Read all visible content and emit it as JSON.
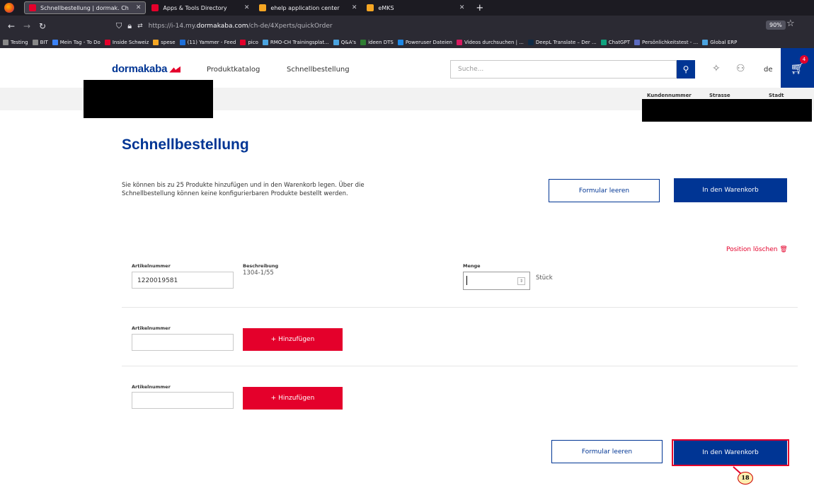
{
  "browser": {
    "tabs": [
      {
        "label": "Schnellbestellung | dormak. Ch",
        "color": "#e4002b",
        "active": true
      },
      {
        "label": "Apps & Tools Directory",
        "color": "#e4002b",
        "active": false
      },
      {
        "label": "ehelp application center",
        "color": "#f5a623",
        "active": false
      },
      {
        "label": "eMKS",
        "color": "#f5a623",
        "active": false
      }
    ],
    "url_prefix": "https://i-14.my.",
    "url_host": "dormakaba.com",
    "url_path": "/ch-de/4Xperts/quickOrder",
    "zoom": "90%",
    "bookmarks": [
      {
        "label": "Testing",
        "color": "#888888"
      },
      {
        "label": "BIT",
        "color": "#888888"
      },
      {
        "label": "Mein Tag - To Do",
        "color": "#3b82f6"
      },
      {
        "label": "Inside Schweiz",
        "color": "#e4002b"
      },
      {
        "label": "spese",
        "color": "#f5a623"
      },
      {
        "label": "(11) Yammer - Feed",
        "color": "#1e6fd9"
      },
      {
        "label": "pico",
        "color": "#e4002b"
      },
      {
        "label": "RMO-CH Trainingsplat...",
        "color": "#4aa3df"
      },
      {
        "label": "Q&A's",
        "color": "#4aa3df"
      },
      {
        "label": "ideen DTS",
        "color": "#2e7d32"
      },
      {
        "label": "Poweruser Dateien",
        "color": "#1e88e5"
      },
      {
        "label": "Videos durchsuchen | ...",
        "color": "#d81b60"
      },
      {
        "label": "DeepL Translate – Der ...",
        "color": "#0f2b46"
      },
      {
        "label": "ChatGPT",
        "color": "#10a37f"
      },
      {
        "label": "Persönlichkeitstest - ...",
        "color": "#5c6bc0"
      },
      {
        "label": "Global ERP",
        "color": "#4aa3df"
      }
    ]
  },
  "header": {
    "logo": "dormakaba",
    "nav": [
      "Produktkatalog",
      "Schnellbestellung"
    ],
    "search_placeholder": "Suche...",
    "language": "de",
    "cart_count": "4",
    "columns": [
      "Kundennummer",
      "Strasse",
      "Stadt"
    ]
  },
  "main": {
    "title": "Schnellbestellung",
    "intro": "Sie können bis zu 25 Produkte hinzufügen und in den Warenkorb legen. Über die Schnellbestellung können keine konfigurierbaren Produkte bestellt werden.",
    "clear_label": "Formular leeren",
    "cart_label": "In den Warenkorb",
    "delete_position": "Position löschen",
    "row1": {
      "article_label": "Artikelnummer",
      "article_value": "1220019581",
      "desc_label": "Beschreibung",
      "desc_value": "1304-1/55",
      "qty_label": "Menge",
      "unit": "Stück"
    },
    "add_rows": [
      {
        "article_label": "Artikelnummer",
        "add_label": "+ Hinzufügen"
      },
      {
        "article_label": "Artikelnummer",
        "add_label": "+ Hinzufügen"
      }
    ],
    "annotation_number": "18"
  }
}
